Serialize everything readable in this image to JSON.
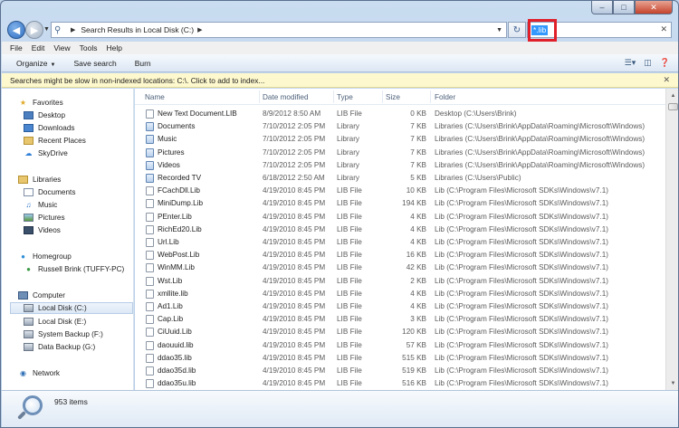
{
  "address": {
    "crumb": "Search Results in Local Disk (C:)"
  },
  "search": {
    "value": "*.lib"
  },
  "menu": [
    "File",
    "Edit",
    "View",
    "Tools",
    "Help"
  ],
  "commands": {
    "organize": "Organize",
    "save_search": "Save search",
    "burn": "Burn"
  },
  "infobar": {
    "text": "Searches might be slow in non-indexed locations: C:\\. Click to add to index..."
  },
  "nav": {
    "favorites": "Favorites",
    "desktop": "Desktop",
    "downloads": "Downloads",
    "recent": "Recent Places",
    "skydrive": "SkyDrive",
    "libraries": "Libraries",
    "documents": "Documents",
    "music": "Music",
    "pictures": "Pictures",
    "videos": "Videos",
    "homegroup": "Homegroup",
    "user": "Russell Brink (TUFFY-PC)",
    "computer": "Computer",
    "local_c": "Local Disk (C:)",
    "local_e": "Local Disk (E:)",
    "backup_f": "System Backup (F:)",
    "backup_g": "Data Backup (G:)",
    "network": "Network"
  },
  "columns": {
    "name": "Name",
    "date": "Date modified",
    "type": "Type",
    "size": "Size",
    "folder": "Folder"
  },
  "rows": [
    {
      "name": "New Text Document.LIB",
      "date": "8/9/2012 8:50 AM",
      "type": "LIB File",
      "size": "0 KB",
      "folder": "Desktop (C:\\Users\\Brink)"
    },
    {
      "name": "Documents",
      "date": "7/10/2012 2:05 PM",
      "type": "Library",
      "size": "7 KB",
      "folder": "Libraries (C:\\Users\\Brink\\AppData\\Roaming\\Microsoft\\Windows)"
    },
    {
      "name": "Music",
      "date": "7/10/2012 2:05 PM",
      "type": "Library",
      "size": "7 KB",
      "folder": "Libraries (C:\\Users\\Brink\\AppData\\Roaming\\Microsoft\\Windows)"
    },
    {
      "name": "Pictures",
      "date": "7/10/2012 2:05 PM",
      "type": "Library",
      "size": "7 KB",
      "folder": "Libraries (C:\\Users\\Brink\\AppData\\Roaming\\Microsoft\\Windows)"
    },
    {
      "name": "Videos",
      "date": "7/10/2012 2:05 PM",
      "type": "Library",
      "size": "7 KB",
      "folder": "Libraries (C:\\Users\\Brink\\AppData\\Roaming\\Microsoft\\Windows)"
    },
    {
      "name": "Recorded TV",
      "date": "6/18/2012 2:50 AM",
      "type": "Library",
      "size": "5 KB",
      "folder": "Libraries (C:\\Users\\Public)"
    },
    {
      "name": "FCachDll.Lib",
      "date": "4/19/2010 8:45 PM",
      "type": "LIB File",
      "size": "10 KB",
      "folder": "Lib (C:\\Program Files\\Microsoft SDKs\\Windows\\v7.1)"
    },
    {
      "name": "MiniDump.Lib",
      "date": "4/19/2010 8:45 PM",
      "type": "LIB File",
      "size": "194 KB",
      "folder": "Lib (C:\\Program Files\\Microsoft SDKs\\Windows\\v7.1)"
    },
    {
      "name": "PEnter.Lib",
      "date": "4/19/2010 8:45 PM",
      "type": "LIB File",
      "size": "4 KB",
      "folder": "Lib (C:\\Program Files\\Microsoft SDKs\\Windows\\v7.1)"
    },
    {
      "name": "RichEd20.Lib",
      "date": "4/19/2010 8:45 PM",
      "type": "LIB File",
      "size": "4 KB",
      "folder": "Lib (C:\\Program Files\\Microsoft SDKs\\Windows\\v7.1)"
    },
    {
      "name": "Url.Lib",
      "date": "4/19/2010 8:45 PM",
      "type": "LIB File",
      "size": "4 KB",
      "folder": "Lib (C:\\Program Files\\Microsoft SDKs\\Windows\\v7.1)"
    },
    {
      "name": "WebPost.Lib",
      "date": "4/19/2010 8:45 PM",
      "type": "LIB File",
      "size": "16 KB",
      "folder": "Lib (C:\\Program Files\\Microsoft SDKs\\Windows\\v7.1)"
    },
    {
      "name": "WinMM.Lib",
      "date": "4/19/2010 8:45 PM",
      "type": "LIB File",
      "size": "42 KB",
      "folder": "Lib (C:\\Program Files\\Microsoft SDKs\\Windows\\v7.1)"
    },
    {
      "name": "Wst.Lib",
      "date": "4/19/2010 8:45 PM",
      "type": "LIB File",
      "size": "2 KB",
      "folder": "Lib (C:\\Program Files\\Microsoft SDKs\\Windows\\v7.1)"
    },
    {
      "name": "xmllite.lib",
      "date": "4/19/2010 8:45 PM",
      "type": "LIB File",
      "size": "4 KB",
      "folder": "Lib (C:\\Program Files\\Microsoft SDKs\\Windows\\v7.1)"
    },
    {
      "name": "Ad1.Lib",
      "date": "4/19/2010 8:45 PM",
      "type": "LIB File",
      "size": "4 KB",
      "folder": "Lib (C:\\Program Files\\Microsoft SDKs\\Windows\\v7.1)"
    },
    {
      "name": "Cap.Lib",
      "date": "4/19/2010 8:45 PM",
      "type": "LIB File",
      "size": "3 KB",
      "folder": "Lib (C:\\Program Files\\Microsoft SDKs\\Windows\\v7.1)"
    },
    {
      "name": "CiUuid.Lib",
      "date": "4/19/2010 8:45 PM",
      "type": "LIB File",
      "size": "120 KB",
      "folder": "Lib (C:\\Program Files\\Microsoft SDKs\\Windows\\v7.1)"
    },
    {
      "name": "daouuid.lib",
      "date": "4/19/2010 8:45 PM",
      "type": "LIB File",
      "size": "57 KB",
      "folder": "Lib (C:\\Program Files\\Microsoft SDKs\\Windows\\v7.1)"
    },
    {
      "name": "ddao35.lib",
      "date": "4/19/2010 8:45 PM",
      "type": "LIB File",
      "size": "515 KB",
      "folder": "Lib (C:\\Program Files\\Microsoft SDKs\\Windows\\v7.1)"
    },
    {
      "name": "ddao35d.lib",
      "date": "4/19/2010 8:45 PM",
      "type": "LIB File",
      "size": "519 KB",
      "folder": "Lib (C:\\Program Files\\Microsoft SDKs\\Windows\\v7.1)"
    },
    {
      "name": "ddao35u.lib",
      "date": "4/19/2010 8:45 PM",
      "type": "LIB File",
      "size": "516 KB",
      "folder": "Lib (C:\\Program Files\\Microsoft SDKs\\Windows\\v7.1)"
    }
  ],
  "status": {
    "count": "953 items"
  },
  "colors": {
    "highlight_box": "#e0202a",
    "selection": "#3399ff",
    "infobar_bg": "#fdf8cd"
  }
}
